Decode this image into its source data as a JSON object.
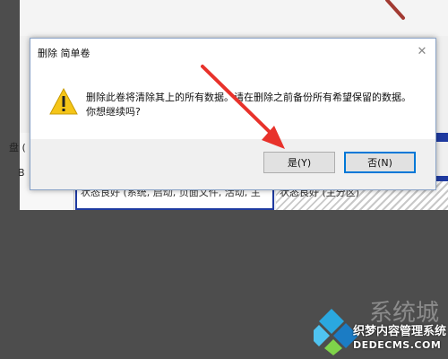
{
  "background": {
    "left_labels": [
      "盘 (",
      "B"
    ],
    "partition1_status": "状态良好 (系统, 启动, 页面文件, 活动, 主",
    "partition2_status": "状态良好 (主分区)"
  },
  "dialog": {
    "title": "删除 简单卷",
    "message": "删除此卷将清除其上的所有数据。请在删除之前备份所有希望保留的数据。你想继续吗?",
    "close_icon": "close-icon",
    "warning_icon": "warning-icon",
    "yes_label": "是(Y)",
    "no_label": "否(N)"
  },
  "watermark": {
    "brand": "系统城",
    "line1": "织梦内容管理系统",
    "line2": "DEDECMS.COM"
  },
  "colors": {
    "accent": "#0078d7",
    "arrow": "#e8322b",
    "warning": "#f5c518"
  }
}
